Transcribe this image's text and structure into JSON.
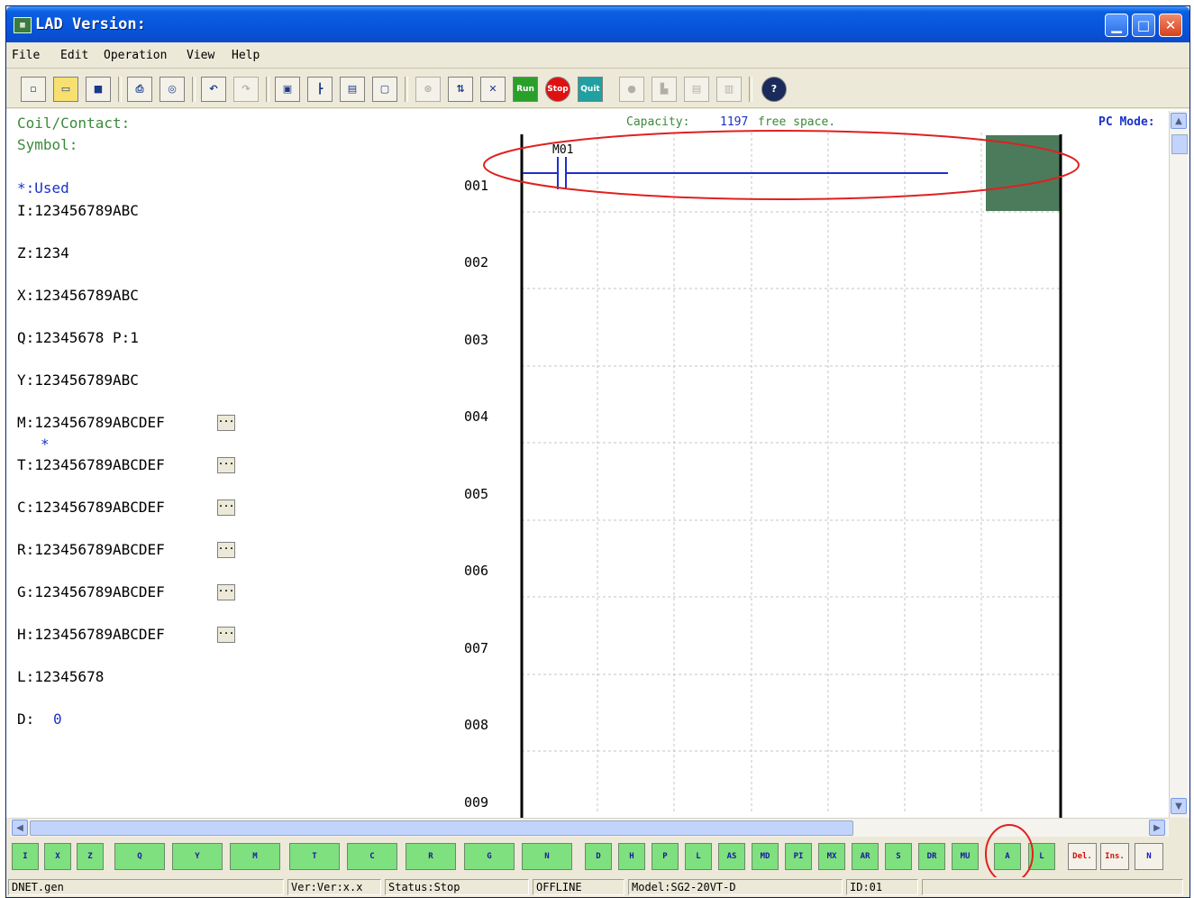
{
  "window": {
    "title": "LAD Version:"
  },
  "menu": [
    "File",
    "Edit",
    "Operation",
    "View",
    "Help"
  ],
  "toolbar": {
    "run": "Run",
    "stop": "Stop",
    "quit": "Quit"
  },
  "info": {
    "coil_contact": "Coil/Contact:",
    "symbol": "Symbol:",
    "capacity_label": "Capacity:",
    "capacity_value": "1197",
    "free_space": "free space.",
    "pc_mode": "PC Mode:"
  },
  "registers": {
    "used_label": "*:Used",
    "I": "I:123456789ABC",
    "Z": "Z:1234",
    "X": "X:123456789ABC",
    "Q": "Q:12345678 P:1",
    "Y": "Y:123456789ABC",
    "M": "M:123456789ABCDEF",
    "M_mark": "*",
    "T": "T:123456789ABCDEF",
    "C": "C:123456789ABCDEF",
    "R": "R:123456789ABCDEF",
    "G": "G:123456789ABCDEF",
    "H": "H:123456789ABCDEF",
    "L": "L:12345678",
    "D_label": "D:",
    "D_value": "0",
    "more_button": "..."
  },
  "ladder": {
    "rows": [
      "001",
      "002",
      "003",
      "004",
      "005",
      "006",
      "007",
      "008",
      "009"
    ],
    "contact_label": "M01",
    "cursor_color": "#4b7b5b",
    "highlight_color": "#e02020"
  },
  "instruction_bar": {
    "contacts": [
      "I",
      "X",
      "Z",
      "Q",
      "Y",
      "M",
      "T",
      "C",
      "R",
      "G",
      "N",
      "D",
      "H",
      "P",
      "L",
      "AS",
      "MD",
      "PI",
      "MX",
      "AR",
      "S",
      "DR",
      "MU",
      "A",
      "L"
    ],
    "delete": "Del.",
    "insert": "Ins.",
    "new": "N"
  },
  "status": {
    "file": "DNET.gen",
    "version": "Ver:Ver:x.x",
    "state": "Status:Stop",
    "connection": "OFFLINE",
    "model": "Model:SG2-20VT-D",
    "id": "ID:01"
  }
}
